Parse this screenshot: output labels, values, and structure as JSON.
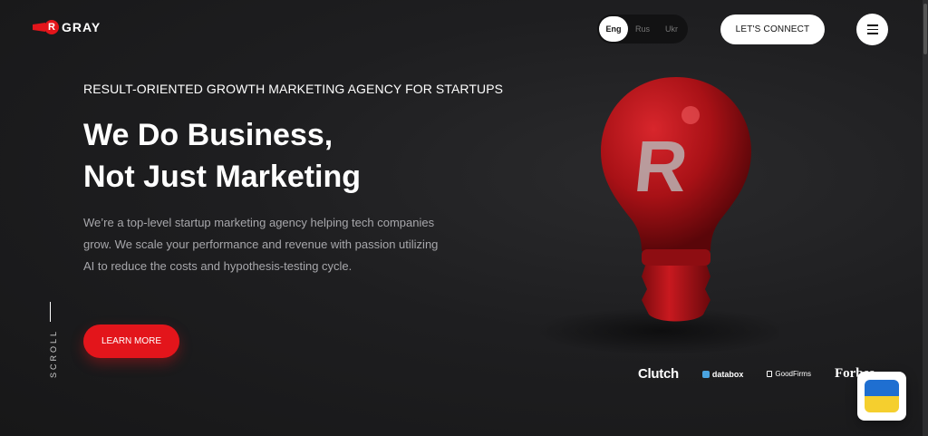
{
  "header": {
    "logo_text": "GRAY",
    "logo_letter": "R",
    "languages": [
      {
        "label": "Eng",
        "active": true
      },
      {
        "label": "Rus",
        "active": false
      },
      {
        "label": "Ukr",
        "active": false
      }
    ],
    "connect_label": "LET'S CONNECT",
    "menu_icon": "hamburger-icon"
  },
  "hero": {
    "subtitle": "RESULT-ORIENTED GROWTH MARKETING AGENCY FOR STARTUPS",
    "headline_line1": "We Do Business,",
    "headline_line2": "Not Just Marketing",
    "description": "We’re a top-level startup marketing agency helping tech companies grow. We scale your performance and revenue with passion utilizing AI to reduce the costs and hypothesis-testing cycle.",
    "cta_label": "LEARN MORE",
    "scroll_label": "SCROLL",
    "bulb_letter": "R"
  },
  "partners": [
    {
      "name": "Clutch"
    },
    {
      "name": "databox"
    },
    {
      "name": "GoodFirms"
    },
    {
      "name": "Forbes"
    }
  ],
  "colors": {
    "accent": "#e3151b",
    "background": "#1e1e20",
    "flag_blue": "#1f6fd1",
    "flag_yellow": "#f5cf2e"
  }
}
